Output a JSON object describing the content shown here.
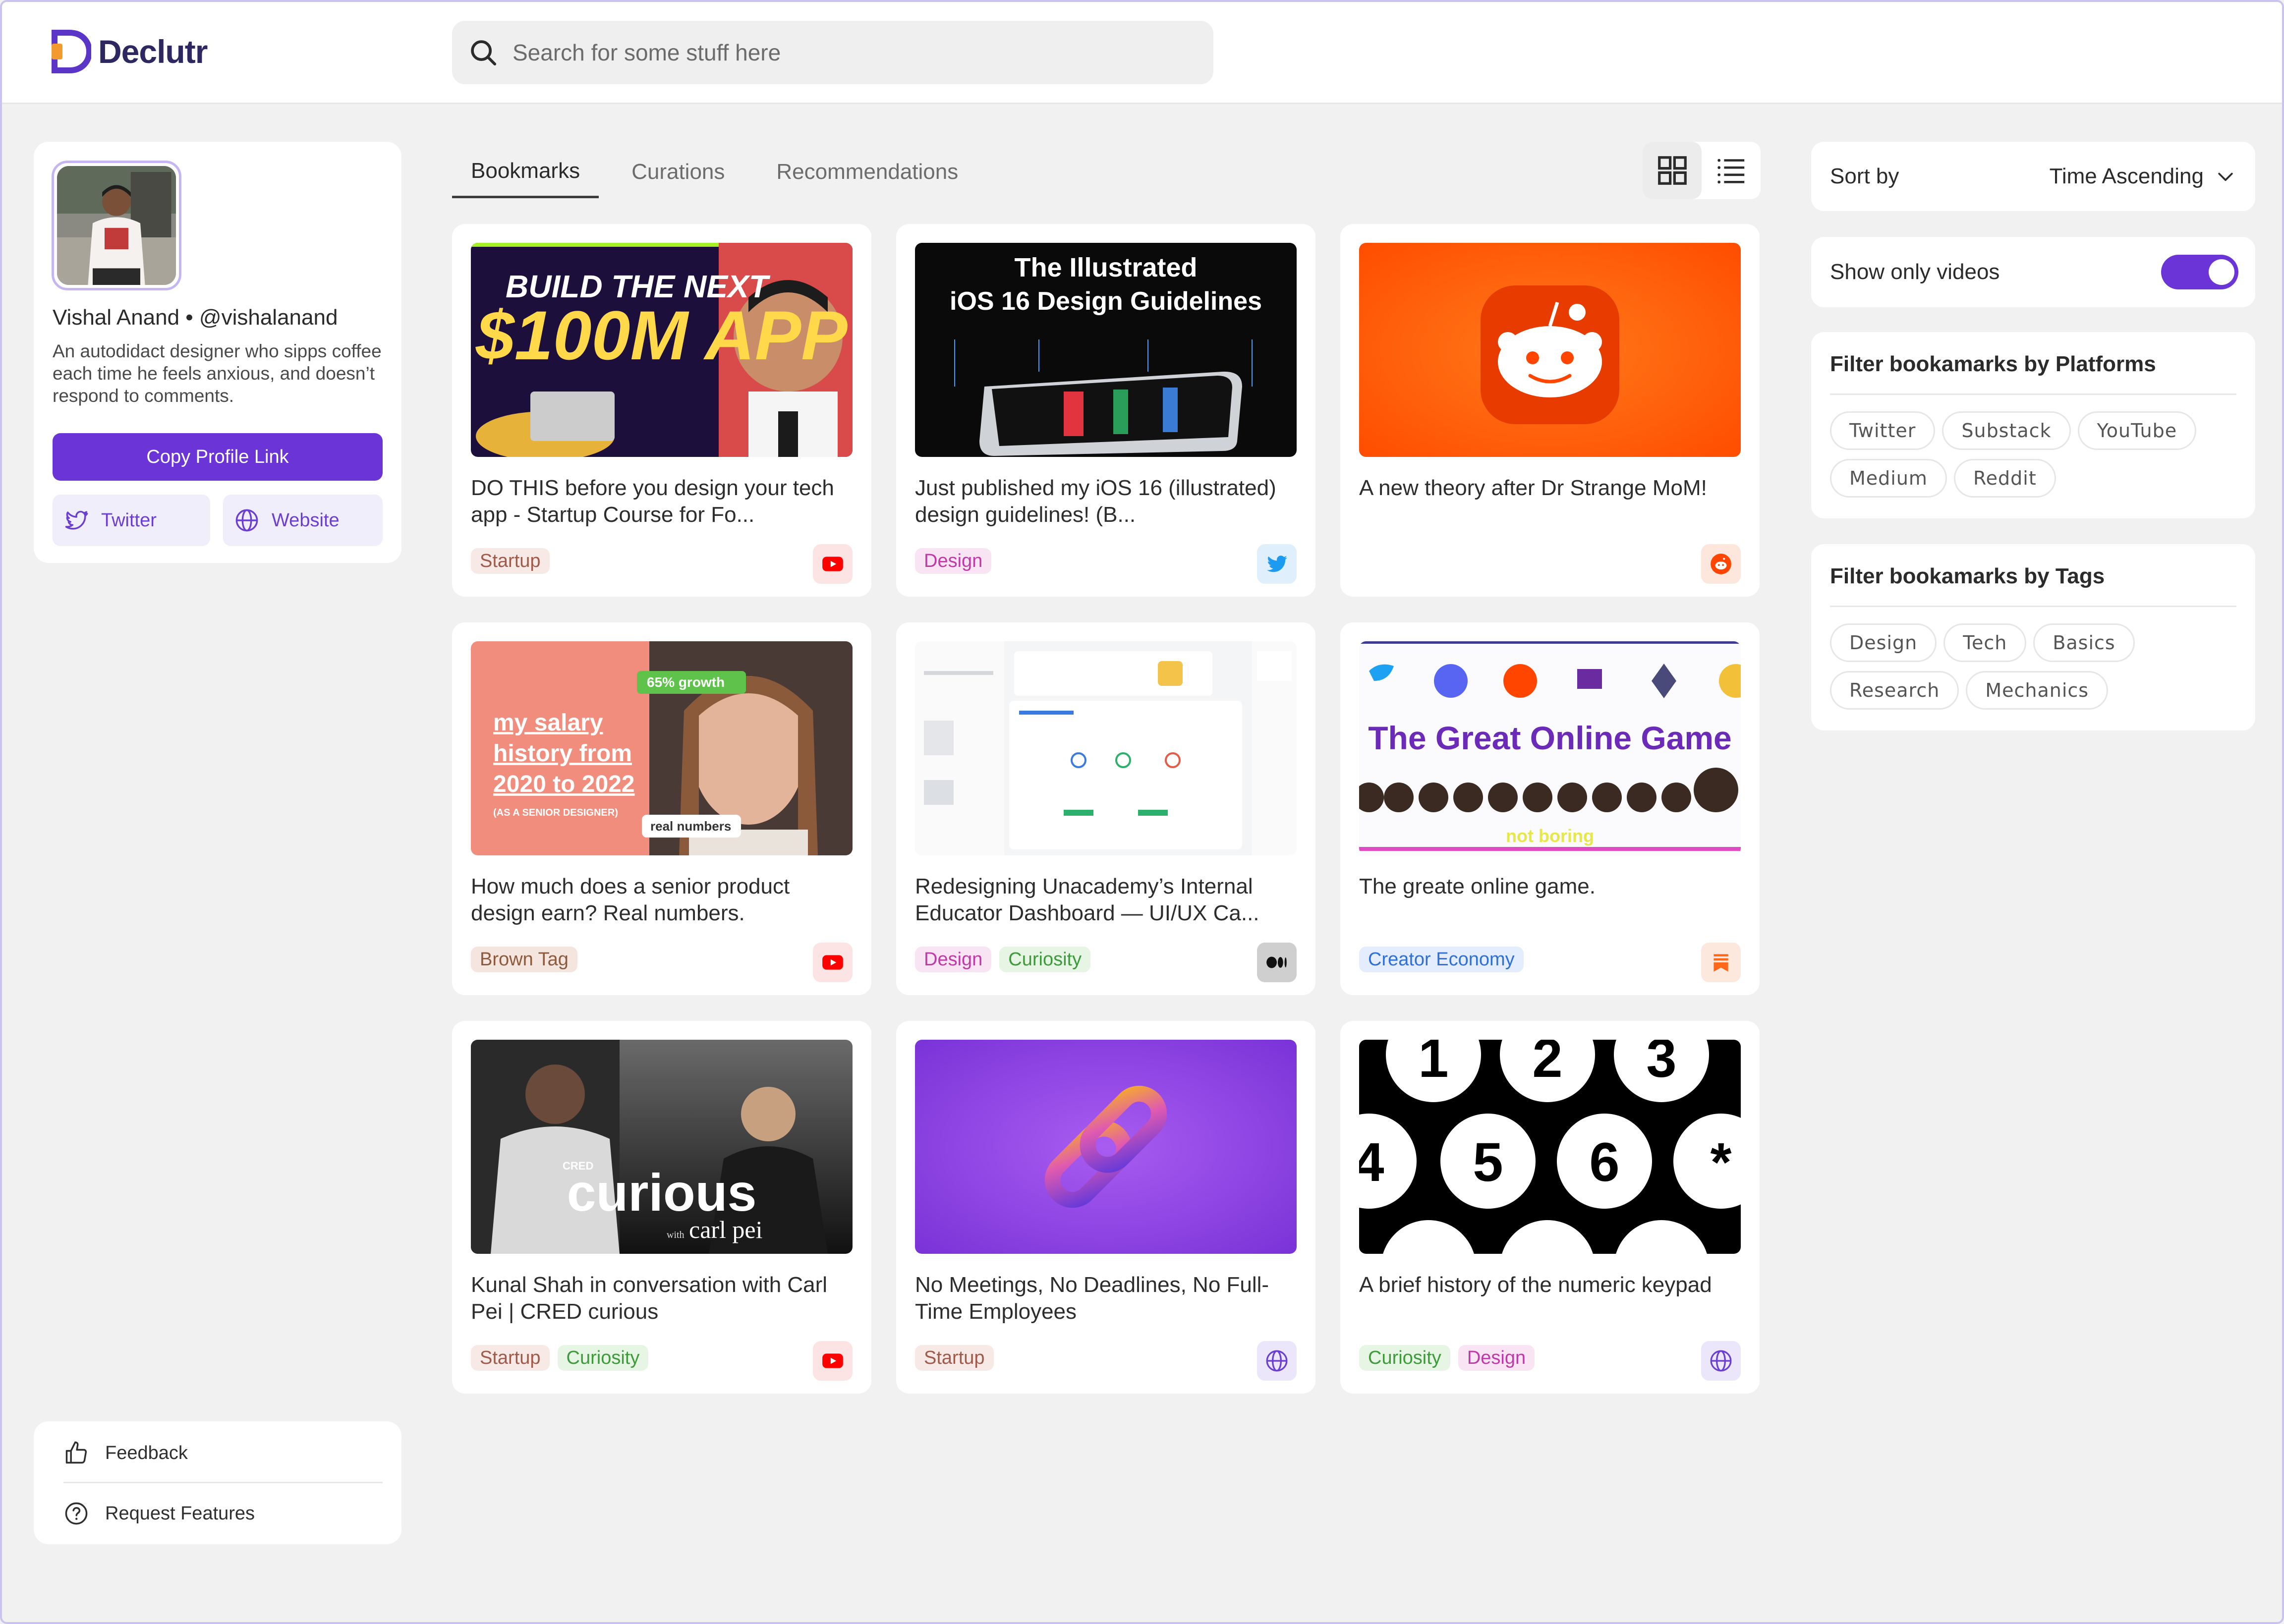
{
  "app": {
    "name": "Declutr"
  },
  "search": {
    "placeholder": "Search for some stuff here"
  },
  "profile": {
    "name_line": "Vishal Anand • @vishalanand",
    "bio": "An autodidact designer who sipps coffee each time he feels anxious, and doesn’t respond to comments.",
    "copy_link_label": "Copy Profile Link",
    "twitter_label": "Twitter",
    "website_label": "Website"
  },
  "footer": {
    "feedback_label": "Feedback",
    "request_label": "Request Features"
  },
  "tabs": [
    {
      "label": "Bookmarks",
      "active": true
    },
    {
      "label": "Curations",
      "active": false
    },
    {
      "label": "Recommendations",
      "active": false
    }
  ],
  "view_mode": "grid",
  "cards": [
    {
      "title": "DO THIS before you design your tech app - Startup Course for Fo...",
      "tags": [
        "Startup"
      ],
      "platform": "youtube-icon",
      "thumb_text": [
        "BUILD THE NEXT",
        "$100M APP"
      ]
    },
    {
      "title": "Just published my iOS 16 (illustrated) design guidelines! (B...",
      "tags": [
        "Design"
      ],
      "platform": "twitter-icon",
      "thumb_text": [
        "The Illustrated",
        "iOS 16 Design Guidelines"
      ]
    },
    {
      "title": "A new theory after Dr Strange MoM!",
      "tags": [],
      "platform": "reddit-icon",
      "thumb_text": []
    },
    {
      "title": "How much does a senior product design earn? Real numbers.",
      "tags": [
        "Brown Tag"
      ],
      "platform": "youtube-icon",
      "thumb_text": [
        "65% growth",
        "my salary",
        "history from",
        "2020 to 2022",
        "(AS A SENIOR DESIGNER)",
        "real numbers"
      ]
    },
    {
      "title": "Redesigning Unacademy’s Internal Educator Dashboard — UI/UX Ca...",
      "tags": [
        "Design",
        "Curiosity"
      ],
      "platform": "medium-icon",
      "thumb_text": []
    },
    {
      "title": "The greate online game.",
      "tags": [
        "Creator Economy"
      ],
      "platform": "substack-icon",
      "thumb_text": [
        "The Great Online Game",
        "not boring"
      ]
    },
    {
      "title": "Kunal Shah in conversation with Carl Pei | CRED curious",
      "tags": [
        "Startup",
        "Curiosity"
      ],
      "platform": "youtube-icon",
      "thumb_text": [
        "CRED",
        "curious",
        "with",
        "carl pei"
      ]
    },
    {
      "title": "No Meetings, No Deadlines, No Full-Time Employees",
      "tags": [
        "Startup"
      ],
      "platform": "website-icon",
      "thumb_text": []
    },
    {
      "title": "A brief history of the numeric keypad",
      "tags": [
        "Curiosity",
        "Design"
      ],
      "platform": "website-icon",
      "thumb_text": [
        "1",
        "2",
        "3",
        "4",
        "5",
        "6",
        "*"
      ]
    }
  ],
  "sort": {
    "label": "Sort by",
    "value": "Time Ascending"
  },
  "videos_toggle": {
    "label": "Show only videos",
    "on": true
  },
  "platform_filter": {
    "title": "Filter bookamarks by Platforms",
    "options": [
      "Twitter",
      "Substack",
      "YouTube",
      "Medium",
      "Reddit"
    ]
  },
  "tag_filter": {
    "title": "Filter bookamarks by Tags",
    "options": [
      "Design",
      "Tech",
      "Basics",
      "Research",
      "Mechanics"
    ]
  },
  "colors": {
    "accent": "#6a34d6",
    "background": "#f1f1f1",
    "frame_border": "#cbc3ef"
  }
}
